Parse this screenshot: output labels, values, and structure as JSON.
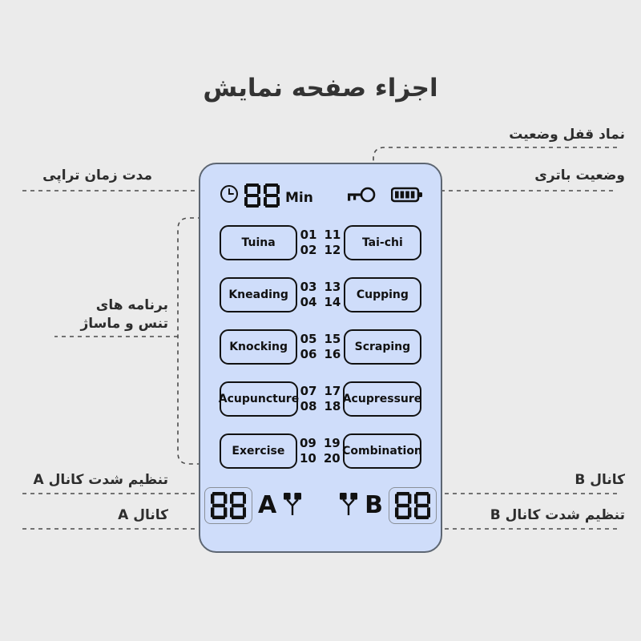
{
  "page": {
    "title": "اجزاء صفحه نمایش",
    "background_color": "#ebebeb",
    "panel_color": "#cfddfa",
    "ink_color": "#111111"
  },
  "device": {
    "status_bar": {
      "clock_icon": "clock-icon",
      "time_value": "88",
      "time_unit": "Min",
      "lock_icon": "key-icon",
      "battery_icon": "battery-icon",
      "battery_bars": 4
    },
    "programs": [
      {
        "left_label": "Tuina",
        "codes_left": [
          "01",
          "02"
        ],
        "codes_right": [
          "11",
          "12"
        ],
        "right_label": "Tai-chi"
      },
      {
        "left_label": "Kneading",
        "codes_left": [
          "03",
          "04"
        ],
        "codes_right": [
          "13",
          "14"
        ],
        "right_label": "Cupping"
      },
      {
        "left_label": "Knocking",
        "codes_left": [
          "05",
          "06"
        ],
        "codes_right": [
          "15",
          "16"
        ],
        "right_label": "Scraping"
      },
      {
        "left_label": "Acupuncture",
        "codes_left": [
          "07",
          "08"
        ],
        "codes_right": [
          "17",
          "18"
        ],
        "right_label": "Acupressure"
      },
      {
        "left_label": "Exercise",
        "codes_left": [
          "09",
          "10"
        ],
        "codes_right": [
          "19",
          "20"
        ],
        "right_label": "Combination"
      }
    ],
    "channels": {
      "a_value": "88",
      "a_letter": "A",
      "a_electrode_icon": "electrode-icon",
      "b_electrode_icon": "electrode-icon",
      "b_letter": "B",
      "b_value": "88"
    }
  },
  "callouts": {
    "therapy_time": "مدت زمان تراپی",
    "programs": "برنامه های\nتنس و ماساژ",
    "channel_a_intensity": "تنظیم شدت کانال A",
    "channel_a": "کانال A",
    "lock_status": "نماد قفل وضعیت",
    "battery_status": "وضعیت باتری",
    "channel_b": "کانال B",
    "channel_b_intensity": "تنظیم شدت کانال B"
  }
}
